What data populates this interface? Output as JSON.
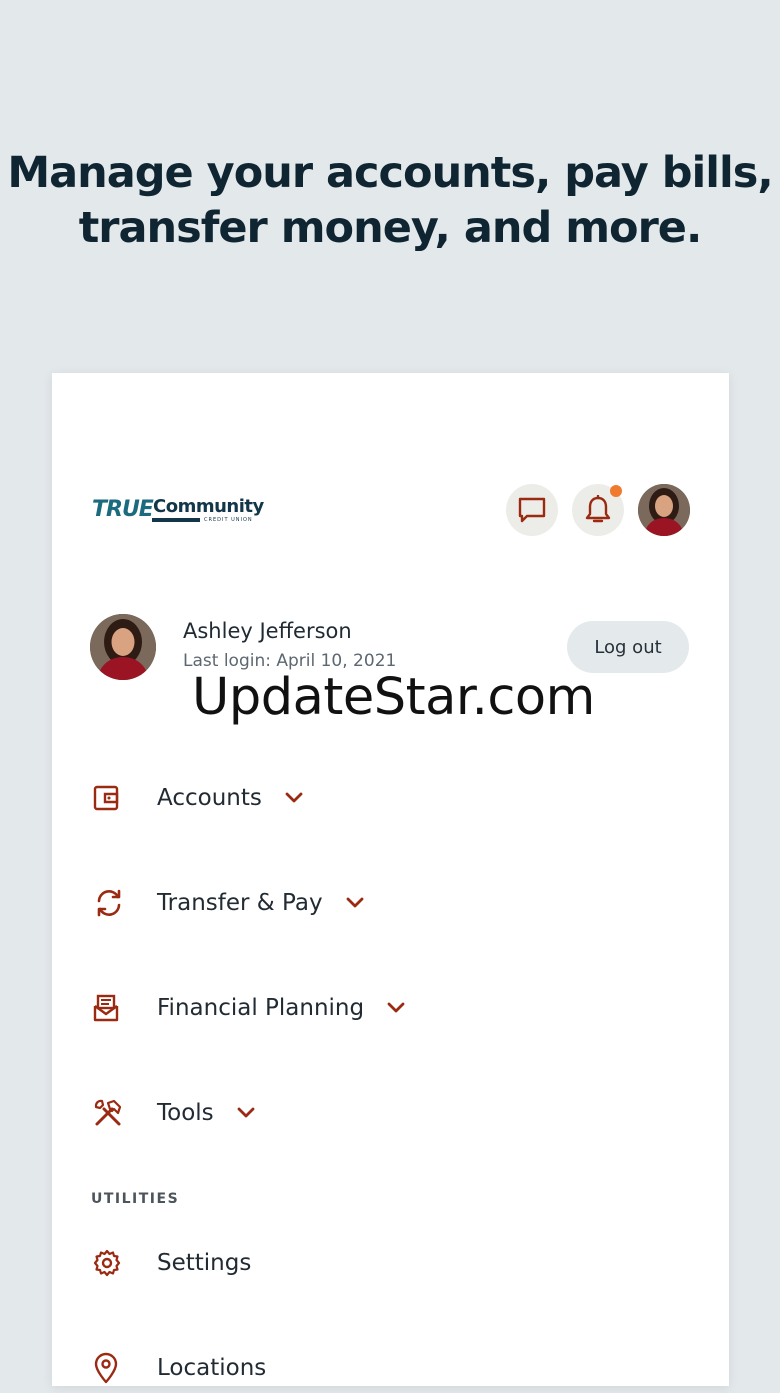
{
  "headline": {
    "line1": "Manage your accounts, pay bills,",
    "line2": "transfer money, and more."
  },
  "logo": {
    "brand_main": "TRUE",
    "brand_secondary": "Community",
    "brand_sub": "CREDIT UNION"
  },
  "header": {
    "icons": [
      "chat-icon",
      "bell-icon",
      "avatar"
    ],
    "has_notification": true
  },
  "user": {
    "name": "Ashley Jefferson",
    "last_login": "Last login: April 10, 2021",
    "logout_label": "Log out"
  },
  "watermark": "UpdateStar.com",
  "menu": {
    "items": [
      {
        "label": "Accounts",
        "icon": "wallet-icon"
      },
      {
        "label": "Transfer & Pay",
        "icon": "transfer-icon"
      },
      {
        "label": "Financial Planning",
        "icon": "planning-icon"
      },
      {
        "label": "Tools",
        "icon": "tools-icon"
      }
    ],
    "utilities_heading": "UTILITIES",
    "utilities": [
      {
        "label": "Settings",
        "icon": "gear-icon"
      },
      {
        "label": "Locations",
        "icon": "location-pin-icon"
      }
    ]
  },
  "colors": {
    "background": "#e3e8eb",
    "card": "#ffffff",
    "accent": "#9a2b12",
    "headline": "#102532",
    "notification_dot": "#f07a2d",
    "logout_button": "#e4eaec",
    "icon_circle": "#ecece8"
  }
}
